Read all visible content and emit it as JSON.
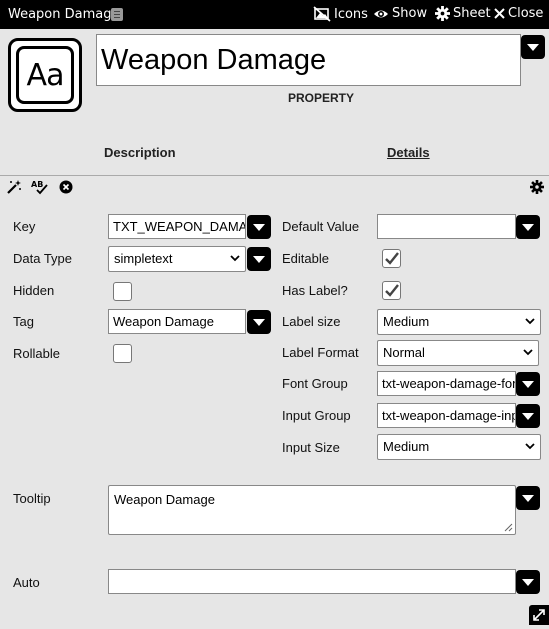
{
  "window": {
    "title": "Weapon Damage",
    "buttons": {
      "icons": "Icons",
      "show": "Show",
      "sheet": "Sheet",
      "close": "Close"
    }
  },
  "header": {
    "avatar_text": "Aa",
    "name": "Weapon Damage",
    "type_label": "PROPERTY"
  },
  "tabs": {
    "description": "Description",
    "details": "Details",
    "active": "details"
  },
  "form": {
    "key": {
      "label": "Key",
      "value": "TXT_WEAPON_DAMAGE"
    },
    "data_type": {
      "label": "Data Type",
      "value": "simpletext"
    },
    "hidden": {
      "label": "Hidden",
      "checked": false
    },
    "tag": {
      "label": "Tag",
      "value": "Weapon Damage"
    },
    "rollable": {
      "label": "Rollable",
      "checked": false
    },
    "default_value": {
      "label": "Default Value",
      "value": ""
    },
    "editable": {
      "label": "Editable",
      "checked": true
    },
    "has_label": {
      "label": "Has Label?",
      "checked": true
    },
    "label_size": {
      "label": "Label size",
      "value": "Medium"
    },
    "label_format": {
      "label": "Label Format",
      "value": "Normal"
    },
    "font_group": {
      "label": "Font Group",
      "value": "txt-weapon-damage-font"
    },
    "input_group": {
      "label": "Input Group",
      "value": "txt-weapon-damage-input"
    },
    "input_size": {
      "label": "Input Size",
      "value": "Medium"
    },
    "tooltip": {
      "label": "Tooltip",
      "value": "Weapon Damage"
    },
    "auto": {
      "label": "Auto",
      "value": ""
    }
  },
  "icons": {
    "icons_btn": "image-off-icon",
    "show_btn": "eye-icon",
    "sheet_btn": "gear-icon",
    "close_btn": "close-icon",
    "magic": "magic-wand-icon",
    "spellcheck": "spellcheck-icon",
    "clear": "clear-circle-icon",
    "settings": "gear-icon",
    "corner": "expand-icon"
  },
  "colors": {
    "titlebar_bg": "#000000",
    "page_bg": "#e6e6e6",
    "accent": "#000000"
  }
}
